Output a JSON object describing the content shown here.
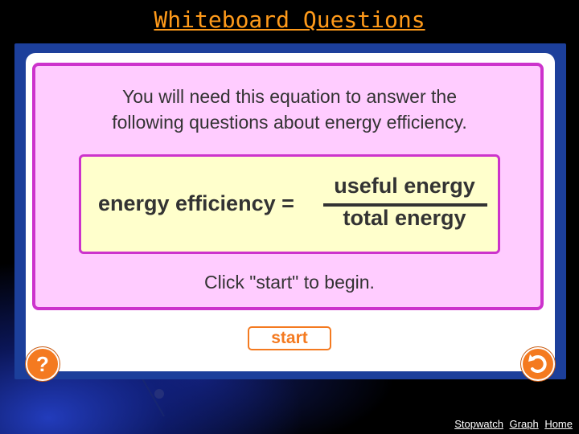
{
  "slide": {
    "title": "Whiteboard Questions"
  },
  "activity": {
    "intro_line1": "You will need this equation to answer the",
    "intro_line2": "following questions about energy efficiency.",
    "equation": {
      "lhs": "energy efficiency =",
      "numerator": "useful energy",
      "denominator": "total energy"
    },
    "prompt": "Click \"start\" to begin.",
    "start_label": "start",
    "help_label": "?"
  },
  "footer": {
    "links": [
      "Stopwatch",
      "Graph",
      "Home"
    ]
  },
  "colors": {
    "title": "#ff9a1a",
    "frame": "#1c3f9b",
    "pink_bg": "#ffccff",
    "pink_border": "#cc33cc",
    "equation_bg": "#ffffcc",
    "accent_orange": "#f47a20"
  },
  "icons": {
    "help": "question-mark-icon",
    "back": "return-arrow-icon"
  }
}
